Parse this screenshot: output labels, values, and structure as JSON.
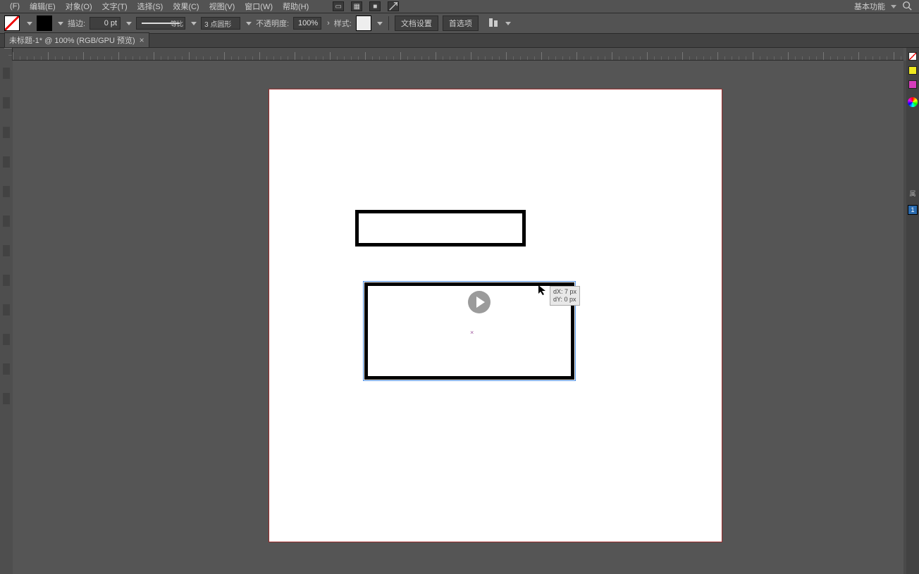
{
  "menu": {
    "items": [
      "(F)",
      "编辑(E)",
      "对象(O)",
      "文字(T)",
      "选择(S)",
      "效果(C)",
      "视图(V)",
      "窗口(W)",
      "帮助(H)"
    ],
    "workspace": "基本功能"
  },
  "options": {
    "stroke_label": "描边:",
    "stroke_value": "0 pt",
    "stroke_style_label": "等比",
    "profile_label": "3 点圆形",
    "opacity_label": "不透明度:",
    "opacity_value": "100%",
    "style_label": "样式:",
    "doc_setup": "文档设置",
    "prefs": "首选项"
  },
  "document": {
    "tab_title": "未标题-1* @ 100% (RGB/GPU 预览)"
  },
  "smartguide": {
    "line1": "dX: 7 px",
    "line2": "dY: 0 px"
  },
  "center_mark": "×",
  "right": {
    "badge": "1"
  }
}
